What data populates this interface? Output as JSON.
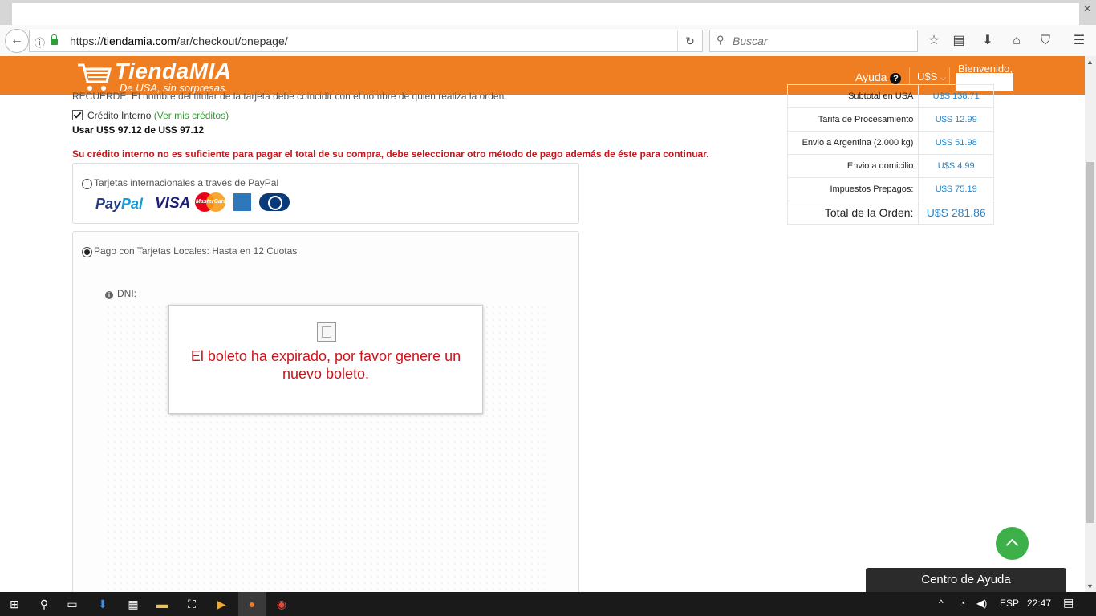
{
  "browser": {
    "url_prefix": "https://",
    "url_host": "tiendamia.com",
    "url_path": "/ar/checkout/onepage/",
    "search_placeholder": "Buscar"
  },
  "header": {
    "logo_name": "TiendaMIA",
    "logo_tagline": "De USA, sin sorpresas.",
    "help_label": "Ayuda",
    "currency_label": "U$S",
    "welcome_label": "Bienvenido,"
  },
  "checkout": {
    "recuerde_text": "RECUERDE: El nombre del titular de la tarjeta debe coincidir con el nombre de quien realiza la orden.",
    "credit_label": "Crédito Interno",
    "credit_link": "(Ver mis créditos)",
    "usar_text": "Usar U$S 97.12 de U$S 97.12",
    "warning_text": "Su crédito interno no es suficiente para pagar el total de su compra, debe seleccionar otro método de pago además de éste para continuar.",
    "option_paypal_label": "Tarjetas internacionales a través de PayPal",
    "paypal_brand_a": "Pay",
    "paypal_brand_b": "Pal",
    "visa_brand": "VISA",
    "mastercard_brand": "MasterCard",
    "option_local_label": "Pago con Tarjetas Locales: Hasta en 12 Cuotas",
    "dni_label": "DNI:",
    "expired_message": "El boleto ha expirado, por favor genere un nuevo boleto."
  },
  "summary": {
    "rows": [
      {
        "label": "Subtotal en USA",
        "value": "U$S 138.71"
      },
      {
        "label": "Tarifa de Procesamiento",
        "value": "U$S 12.99"
      },
      {
        "label": "Envio a Argentina (2.000 kg)",
        "value": "U$S 51.98"
      },
      {
        "label": "Envio a domicilio",
        "value": "U$S 4.99"
      },
      {
        "label": "Impuestos Prepagos:",
        "value": "U$S 75.19"
      }
    ],
    "total_label": "Total de la Orden:",
    "total_value": "U$S 281.86"
  },
  "floating": {
    "help_center_label": "Centro de Ayuda"
  },
  "taskbar": {
    "language": "ESP",
    "time": "22:47"
  },
  "colors": {
    "brand_orange": "#ef7e22",
    "warning_red": "#c8161d",
    "link_blue": "#2a86c8",
    "green_button": "#3db04a"
  }
}
